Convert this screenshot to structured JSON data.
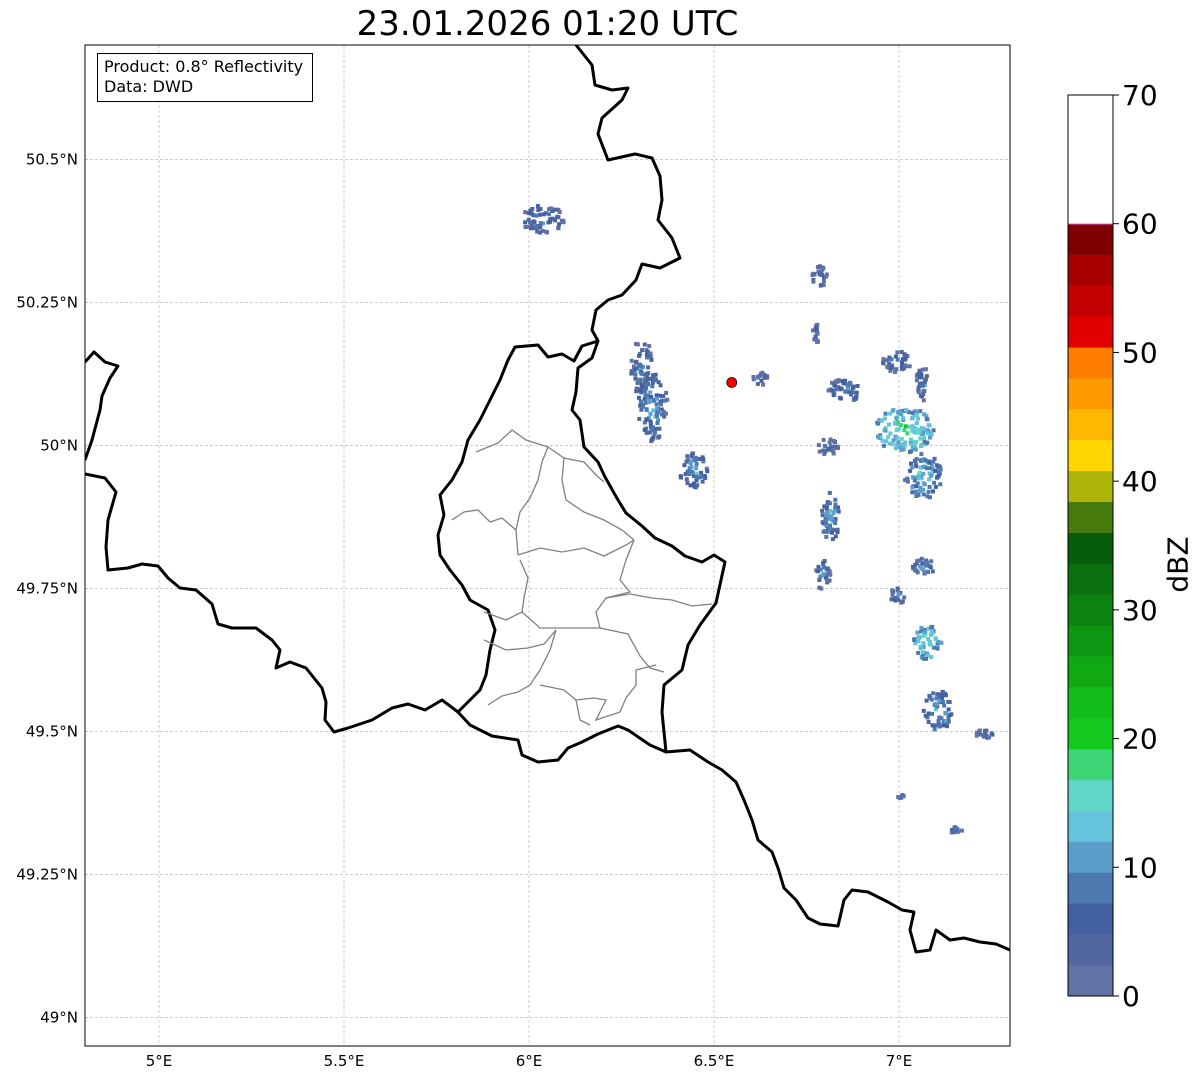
{
  "title": "23.01.2026 01:20 UTC",
  "info": {
    "product": "Product: 0.8° Reflectivity",
    "source": "Data: DWD"
  },
  "map": {
    "projection": "PlateCarree",
    "lon_range": [
      4.8,
      7.3
    ],
    "lat_range": [
      48.95,
      50.7
    ],
    "gridlines": true,
    "lon_ticks": [
      {
        "value": 5.0,
        "label": "5°E"
      },
      {
        "value": 5.5,
        "label": "5.5°E"
      },
      {
        "value": 6.0,
        "label": "6°E"
      },
      {
        "value": 6.5,
        "label": "6.5°E"
      },
      {
        "value": 7.0,
        "label": "7°E"
      }
    ],
    "lat_ticks": [
      {
        "value": 50.5,
        "label": "50.5°N"
      },
      {
        "value": 50.25,
        "label": "50.25°N"
      },
      {
        "value": 50.0,
        "label": "50°N"
      },
      {
        "value": 49.75,
        "label": "49.75°N"
      },
      {
        "value": 49.5,
        "label": "49.5°N"
      },
      {
        "value": 49.25,
        "label": "49.25°N"
      },
      {
        "value": 49.0,
        "label": "49°N"
      }
    ],
    "radar_site": {
      "lon": 6.548,
      "lat": 50.11,
      "color": "#ff0000"
    },
    "border_color": "#000000",
    "district_color": "#808080"
  },
  "colorbar": {
    "label": "dBZ",
    "min": 0,
    "max": 70,
    "tick_labels": [
      {
        "value": 0,
        "label": "0"
      },
      {
        "value": 10,
        "label": "10"
      },
      {
        "value": 20,
        "label": "20"
      },
      {
        "value": 30,
        "label": "30"
      },
      {
        "value": 40,
        "label": "40"
      },
      {
        "value": 50,
        "label": "50"
      },
      {
        "value": 60,
        "label": "60"
      },
      {
        "value": 70,
        "label": "70"
      }
    ],
    "colors": [
      "#6272a6",
      "#5267a0",
      "#4360a0",
      "#4d78b0",
      "#5a9ec9",
      "#66c3dd",
      "#60d6c8",
      "#3dd677",
      "#14c91e",
      "#12bc19",
      "#10a914",
      "#0e9612",
      "#0c8310",
      "#0a700d",
      "#085d0b",
      "#467a0a",
      "#adb50b",
      "#ffd700",
      "#ffb700",
      "#ff9a00",
      "#ff7d00",
      "#e00000",
      "#c40000",
      "#a80000",
      "#7f0000",
      "#ffdfff",
      "#ffb2ff",
      "#ff6bff",
      "#ec38ec"
    ]
  },
  "echoes": [
    {
      "lon": 6.03,
      "lat": 50.4,
      "rx": 0.06,
      "ry": 0.025,
      "dbz": 10
    },
    {
      "lon": 6.3,
      "lat": 50.14,
      "rx": 0.03,
      "ry": 0.05,
      "dbz": 10
    },
    {
      "lon": 6.33,
      "lat": 50.07,
      "rx": 0.04,
      "ry": 0.06,
      "dbz": 12
    },
    {
      "lon": 6.44,
      "lat": 49.96,
      "rx": 0.04,
      "ry": 0.03,
      "dbz": 12
    },
    {
      "lon": 6.62,
      "lat": 50.12,
      "rx": 0.02,
      "ry": 0.012,
      "dbz": 8
    },
    {
      "lon": 6.78,
      "lat": 50.3,
      "rx": 0.02,
      "ry": 0.02,
      "dbz": 8
    },
    {
      "lon": 6.77,
      "lat": 50.2,
      "rx": 0.01,
      "ry": 0.02,
      "dbz": 8
    },
    {
      "lon": 6.85,
      "lat": 50.1,
      "rx": 0.05,
      "ry": 0.02,
      "dbz": 10
    },
    {
      "lon": 6.8,
      "lat": 50.0,
      "rx": 0.03,
      "ry": 0.015,
      "dbz": 8
    },
    {
      "lon": 6.81,
      "lat": 49.88,
      "rx": 0.025,
      "ry": 0.045,
      "dbz": 13
    },
    {
      "lon": 6.79,
      "lat": 49.78,
      "rx": 0.02,
      "ry": 0.03,
      "dbz": 10
    },
    {
      "lon": 7.01,
      "lat": 50.03,
      "rx": 0.08,
      "ry": 0.04,
      "dbz": 18
    },
    {
      "lon": 7.06,
      "lat": 49.95,
      "rx": 0.05,
      "ry": 0.04,
      "dbz": 14
    },
    {
      "lon": 6.99,
      "lat": 50.15,
      "rx": 0.04,
      "ry": 0.02,
      "dbz": 9
    },
    {
      "lon": 7.06,
      "lat": 50.11,
      "rx": 0.02,
      "ry": 0.03,
      "dbz": 9
    },
    {
      "lon": 7.06,
      "lat": 49.79,
      "rx": 0.03,
      "ry": 0.02,
      "dbz": 11
    },
    {
      "lon": 6.99,
      "lat": 49.74,
      "rx": 0.02,
      "ry": 0.015,
      "dbz": 10
    },
    {
      "lon": 7.07,
      "lat": 49.66,
      "rx": 0.04,
      "ry": 0.03,
      "dbz": 17
    },
    {
      "lon": 7.1,
      "lat": 49.54,
      "rx": 0.04,
      "ry": 0.035,
      "dbz": 13
    },
    {
      "lon": 7.23,
      "lat": 49.5,
      "rx": 0.03,
      "ry": 0.008,
      "dbz": 9
    },
    {
      "lon": 7.15,
      "lat": 49.33,
      "rx": 0.015,
      "ry": 0.008,
      "dbz": 9
    },
    {
      "lon": 7.0,
      "lat": 49.39,
      "rx": 0.01,
      "ry": 0.004,
      "dbz": 8
    }
  ]
}
